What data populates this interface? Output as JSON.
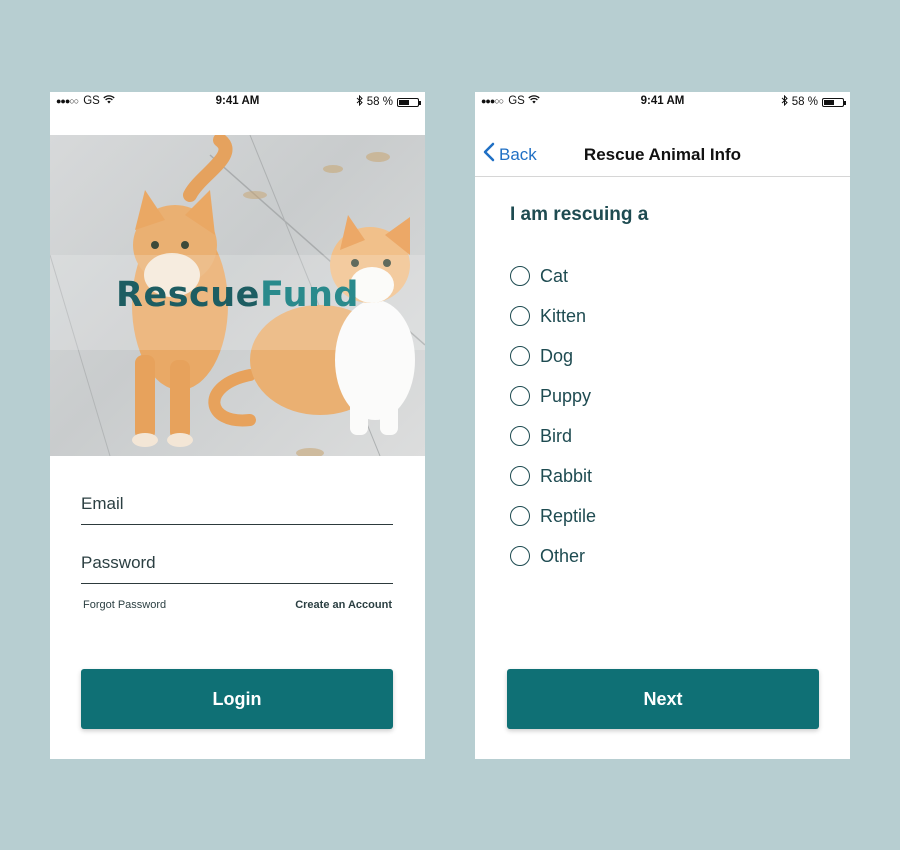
{
  "status_bar": {
    "carrier": "GS",
    "time": "9:41 AM",
    "battery": "58 %",
    "battery_level": 0.58
  },
  "login": {
    "logo": {
      "part1": "Rescue",
      "part2": "Fund"
    },
    "email_placeholder": "Email",
    "password_placeholder": "Password",
    "forgot_label": "Forgot Password",
    "create_label": "Create an Account",
    "login_label": "Login",
    "brand_color": "#0f7075"
  },
  "info": {
    "back_label": "Back",
    "title": "Rescue Animal Info",
    "question": "I am rescuing a",
    "options": [
      "Cat",
      "Kitten",
      "Dog",
      "Puppy",
      "Bird",
      "Rabbit",
      "Reptile",
      "Other"
    ],
    "next_label": "Next"
  },
  "icons": {
    "signal": "signal-dots-icon",
    "wifi": "wifi-icon",
    "bluetooth": "bluetooth-icon",
    "battery": "battery-icon",
    "back": "chevron-left-icon",
    "radio": "radio-unselected-icon"
  }
}
